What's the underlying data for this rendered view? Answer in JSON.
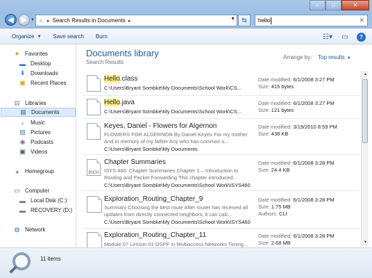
{
  "address": {
    "crumb": "Search Results in Documents"
  },
  "search": {
    "value": "hello"
  },
  "toolbar": {
    "organize": "Organize",
    "save_search": "Save search",
    "burn": "Burn"
  },
  "nav": {
    "favorites": "Favorites",
    "desktop": "Desktop",
    "downloads": "Downloads",
    "recent": "Recent Places",
    "libraries": "Libraries",
    "documents": "Documents",
    "music": "Music",
    "pictures": "Pictures",
    "podcasts": "Podcasts",
    "videos": "Videos",
    "homegroup": "Homegroup",
    "computer": "Computer",
    "local_disk": "Local Disk (C:)",
    "recovery": "RECOVERY (D:)",
    "network": "Network"
  },
  "content": {
    "title": "Documents library",
    "subtitle": "Search Results",
    "arrange_label": "Arrange by:",
    "arrange_value": "Top results"
  },
  "results": [
    {
      "name_hl": "Hello",
      "name_rest": ".class",
      "snippet": "",
      "path": "C:\\Users\\Bryant Sombke\\My Documents\\School Work\\CS...",
      "date_label": "Date modified:",
      "date": "6/1/2008 3:27 PM",
      "size_label": "Size:",
      "size": "415 bytes"
    },
    {
      "name_hl": "Hello",
      "name_rest": ".java",
      "snippet": "",
      "path": "C:\\Users\\Bryant Sombke\\My Documents\\School Work\\CS...",
      "date_label": "Date modified:",
      "date": "6/1/2008 3:27 PM",
      "size_label": "Size:",
      "size": "121 bytes"
    },
    {
      "name_hl": "",
      "name_rest": "Keyes, Daniel - Flowers for Algernon",
      "snippet": "FLOWERS FOR ALGERNON By Daniel Keyes For my mother And in memory of my father Any who has common s...",
      "path": "C:\\Users\\Bryant Sombke\\My Documents",
      "date_label": "Date modified:",
      "date": "3/19/2010 8:59 PM",
      "size_label": "Size:",
      "size": "438 KB"
    },
    {
      "name_hl": "",
      "name_rest": "Chapter Summaries",
      "snippet": "ISYS 460: Chapter Summaries Chapter 1 – Introduction to Routing and Packet Forwarding This chapter introduced...",
      "path": "C:\\Users\\Bryant Sombke\\My Documents\\School Work\\ISYS460",
      "date_label": "Date modified:",
      "date": "6/1/2008 3:28 PM",
      "size_label": "Size:",
      "size": "24.4 KB"
    },
    {
      "name_hl": "",
      "name_rest": "Exploration_Routing_Chapter_9",
      "snippet": "Summary Choosing the best route After router has received all updates from directly connected neighbors, it can calc...",
      "path": "C:\\Users\\Bryant Sombke\\My Documents\\School Work\\ISYS460",
      "date_label": "Date modified:",
      "date": "6/1/2008 3:28 PM",
      "size_label": "Size:",
      "size": "1.75 MB",
      "authors_label": "Authors:",
      "authors": "CLI"
    },
    {
      "name_hl": "",
      "name_rest": "Exploration_Routing_Chapter_11",
      "snippet": "Module 07 Lesson 01 OSPF in Multiaccess Networks Timing...",
      "path": "",
      "date_label": "Date modified:",
      "date": "6/1/2008 3:28 PM",
      "size_label": "Size:",
      "size": "2.68 MB"
    }
  ],
  "status": {
    "count": "11 items"
  }
}
